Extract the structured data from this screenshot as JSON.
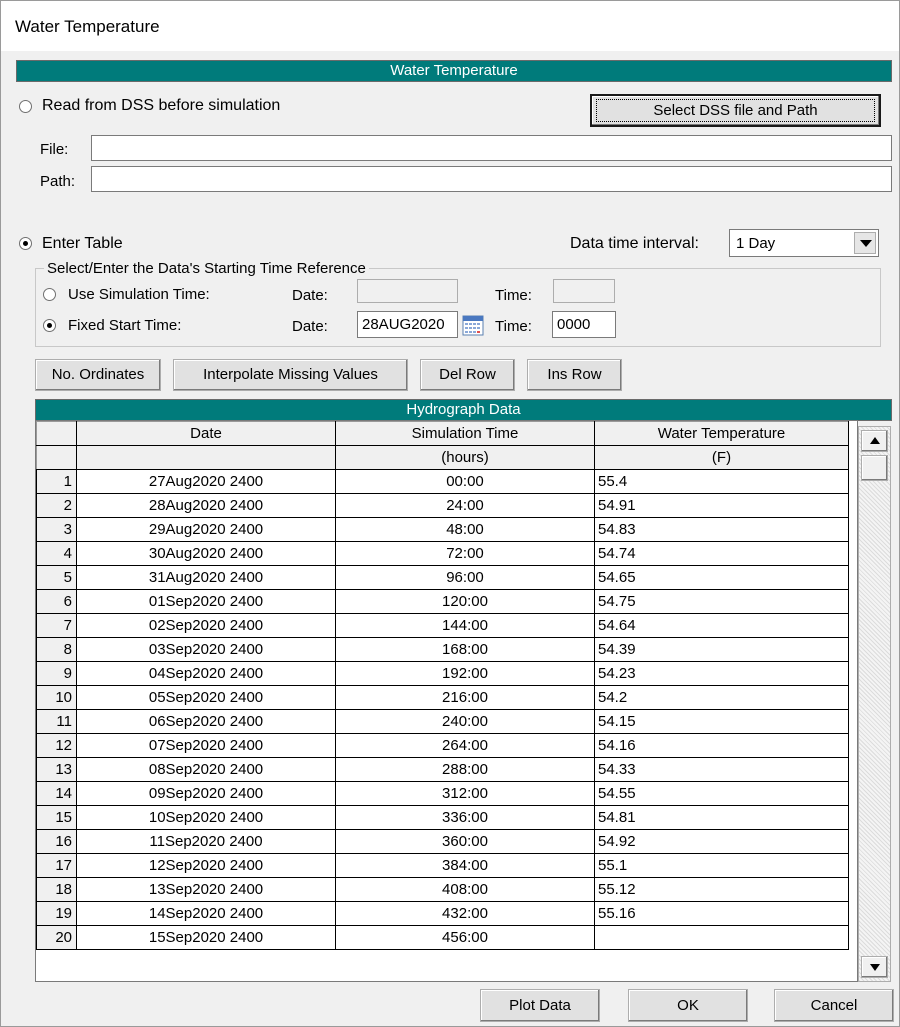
{
  "window": {
    "title": "Water Temperature"
  },
  "section_header": "Water Temperature",
  "dss": {
    "radio_label": "Read from DSS before simulation",
    "select_button": "Select DSS file and Path",
    "file_label": "File:",
    "file_value": "",
    "path_label": "Path:",
    "path_value": ""
  },
  "enter_table": {
    "radio_label": "Enter Table",
    "interval_label": "Data time interval:",
    "interval_value": "1 Day"
  },
  "time_reference": {
    "group_title": "Select/Enter the Data's Starting Time Reference",
    "use_sim_label": "Use Simulation Time:",
    "fixed_label": "Fixed Start Time:",
    "date_label": "Date:",
    "time_label": "Time:",
    "sim_date_value": "",
    "sim_time_value": "",
    "fixed_date_value": "28AUG2020",
    "fixed_time_value": "0000"
  },
  "toolbar": {
    "no_ordinates": "No. Ordinates",
    "interpolate": "Interpolate Missing Values",
    "del_row": "Del Row",
    "ins_row": "Ins Row"
  },
  "table": {
    "title": "Hydrograph Data",
    "columns": [
      {
        "header": "Date",
        "unit": ""
      },
      {
        "header": "Simulation Time",
        "unit": "(hours)"
      },
      {
        "header": "Water Temperature",
        "unit": "(F)"
      }
    ],
    "rows": [
      {
        "n": "1",
        "date": "27Aug2020 2400",
        "time": "00:00",
        "temp": "55.4"
      },
      {
        "n": "2",
        "date": "28Aug2020 2400",
        "time": "24:00",
        "temp": "54.91"
      },
      {
        "n": "3",
        "date": "29Aug2020 2400",
        "time": "48:00",
        "temp": "54.83"
      },
      {
        "n": "4",
        "date": "30Aug2020 2400",
        "time": "72:00",
        "temp": "54.74"
      },
      {
        "n": "5",
        "date": "31Aug2020 2400",
        "time": "96:00",
        "temp": "54.65"
      },
      {
        "n": "6",
        "date": "01Sep2020 2400",
        "time": "120:00",
        "temp": "54.75"
      },
      {
        "n": "7",
        "date": "02Sep2020 2400",
        "time": "144:00",
        "temp": "54.64"
      },
      {
        "n": "8",
        "date": "03Sep2020 2400",
        "time": "168:00",
        "temp": "54.39"
      },
      {
        "n": "9",
        "date": "04Sep2020 2400",
        "time": "192:00",
        "temp": "54.23"
      },
      {
        "n": "10",
        "date": "05Sep2020 2400",
        "time": "216:00",
        "temp": "54.2"
      },
      {
        "n": "11",
        "date": "06Sep2020 2400",
        "time": "240:00",
        "temp": "54.15"
      },
      {
        "n": "12",
        "date": "07Sep2020 2400",
        "time": "264:00",
        "temp": "54.16"
      },
      {
        "n": "13",
        "date": "08Sep2020 2400",
        "time": "288:00",
        "temp": "54.33"
      },
      {
        "n": "14",
        "date": "09Sep2020 2400",
        "time": "312:00",
        "temp": "54.55"
      },
      {
        "n": "15",
        "date": "10Sep2020 2400",
        "time": "336:00",
        "temp": "54.81"
      },
      {
        "n": "16",
        "date": "11Sep2020 2400",
        "time": "360:00",
        "temp": "54.92"
      },
      {
        "n": "17",
        "date": "12Sep2020 2400",
        "time": "384:00",
        "temp": "55.1"
      },
      {
        "n": "18",
        "date": "13Sep2020 2400",
        "time": "408:00",
        "temp": "55.12"
      },
      {
        "n": "19",
        "date": "14Sep2020 2400",
        "time": "432:00",
        "temp": "55.16"
      },
      {
        "n": "20",
        "date": "15Sep2020 2400",
        "time": "456:00",
        "temp": ""
      }
    ]
  },
  "footer": {
    "plot": "Plot Data",
    "ok": "OK",
    "cancel": "Cancel"
  },
  "colors": {
    "header_teal": "#007b7b"
  },
  "icons": {
    "calendar": "calendar-icon"
  }
}
